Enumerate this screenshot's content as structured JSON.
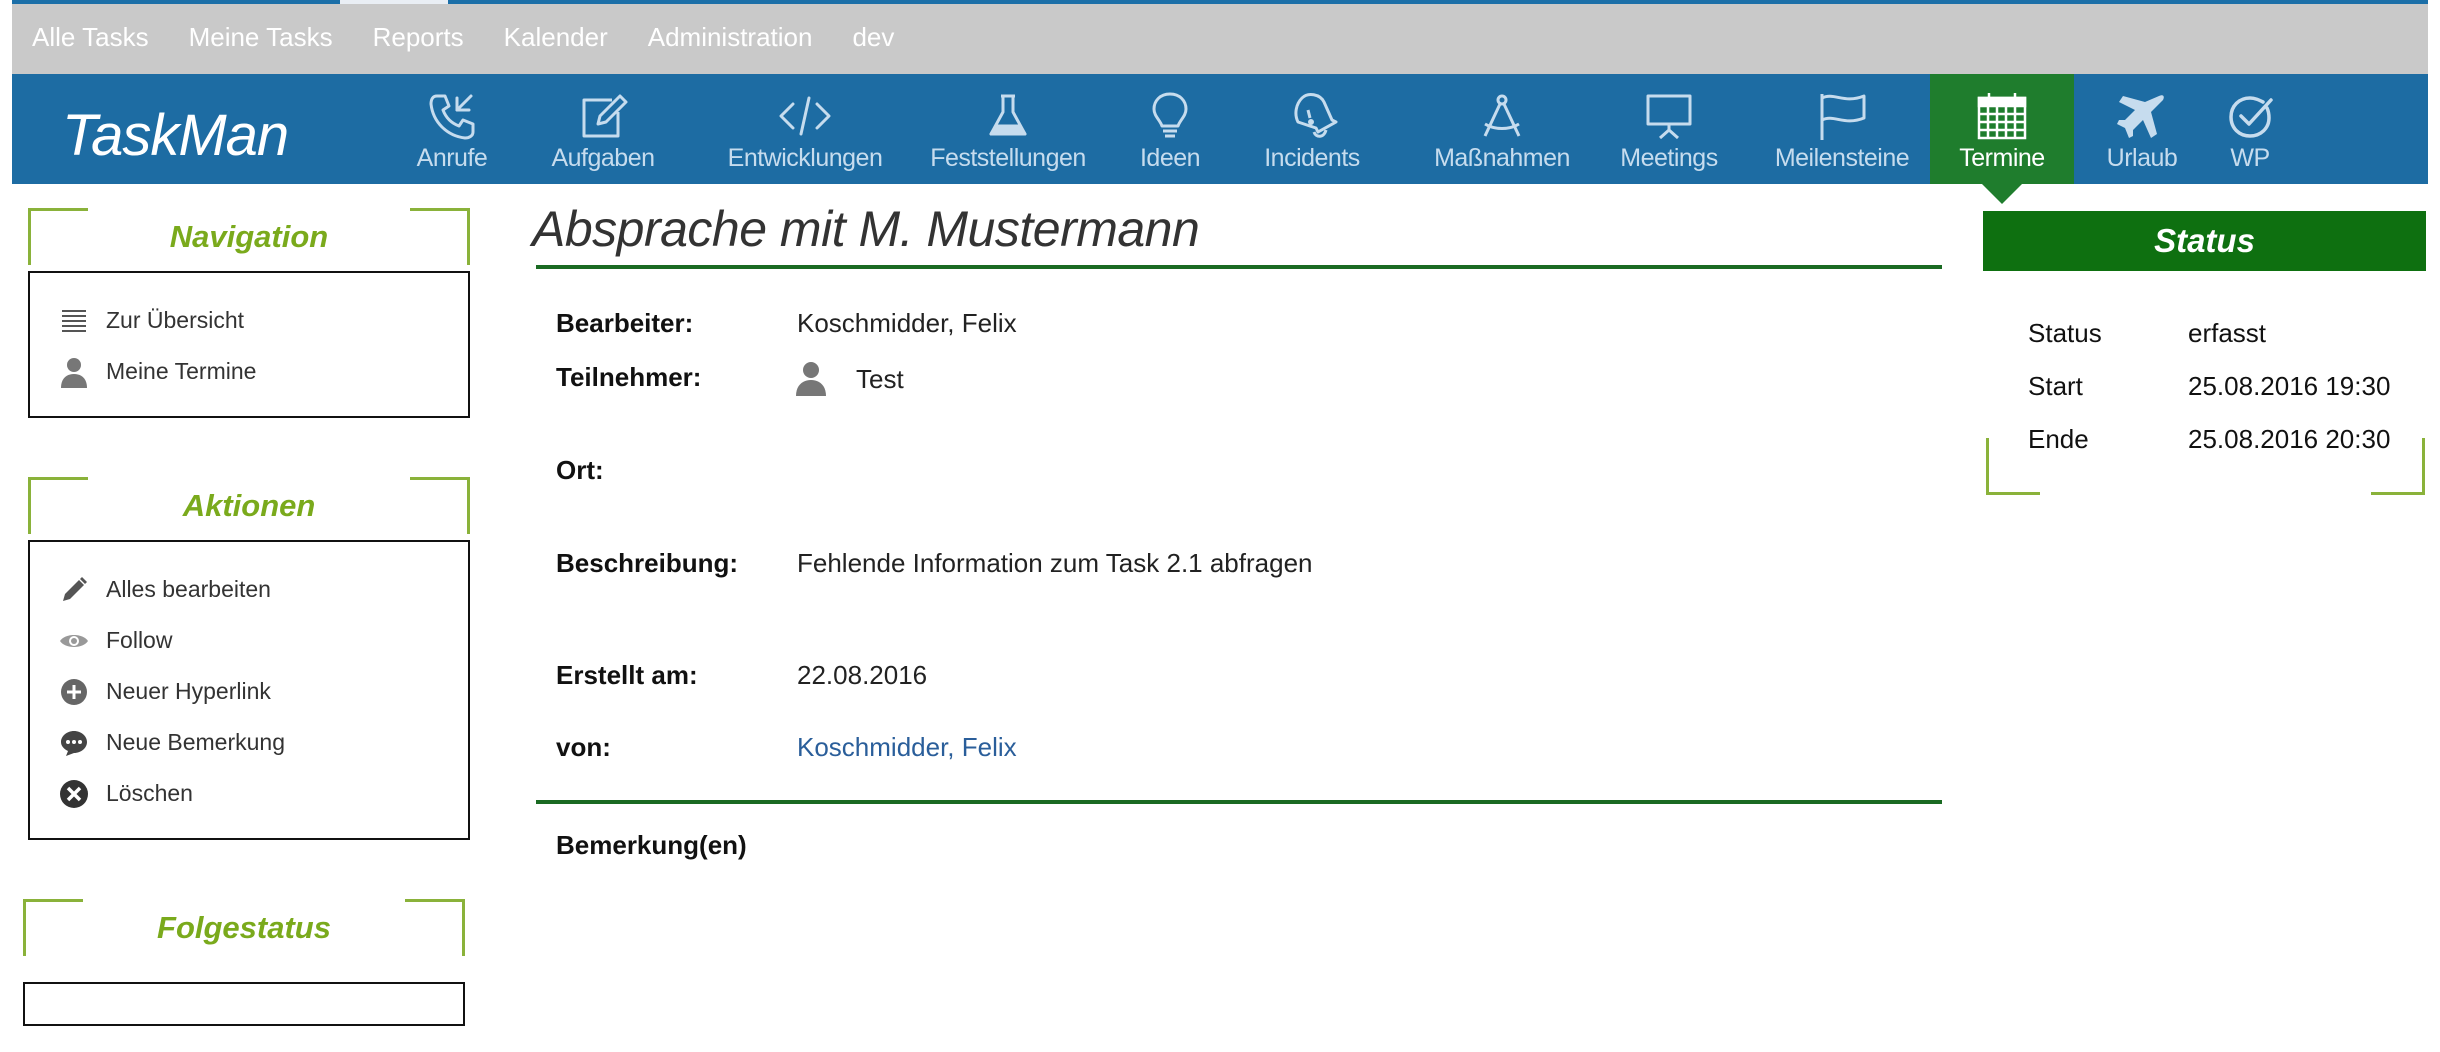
{
  "top_nav": [
    "Alle Tasks",
    "Meine Tasks",
    "Reports",
    "Kalender",
    "Administration",
    "dev"
  ],
  "header": {
    "logo": "TaskMan",
    "items": [
      {
        "label": "Anrufe",
        "icon": "phone-icon"
      },
      {
        "label": "Aufgaben",
        "icon": "edit-icon"
      },
      {
        "label": "Entwicklungen",
        "icon": "code-icon"
      },
      {
        "label": "Feststellungen",
        "icon": "flask-icon"
      },
      {
        "label": "Ideen",
        "icon": "lightbulb-icon"
      },
      {
        "label": "Incidents",
        "icon": "bell-icon"
      },
      {
        "label": "Maßnahmen",
        "icon": "compass-icon"
      },
      {
        "label": "Meetings",
        "icon": "presentation-icon"
      },
      {
        "label": "Meilensteine",
        "icon": "flag-icon"
      },
      {
        "label": "Termine",
        "icon": "calendar-icon",
        "active": true
      },
      {
        "label": "Urlaub",
        "icon": "airplane-icon"
      },
      {
        "label": "WP",
        "icon": "check-circle-icon"
      }
    ]
  },
  "sidebar": {
    "navigation": {
      "title": "Navigation",
      "items": [
        {
          "label": "Zur Übersicht",
          "icon": "list-icon"
        },
        {
          "label": "Meine Termine",
          "icon": "person-icon"
        }
      ]
    },
    "actions": {
      "title": "Aktionen",
      "items": [
        {
          "label": "Alles bearbeiten",
          "icon": "pencil-icon"
        },
        {
          "label": "Follow",
          "icon": "eye-icon"
        },
        {
          "label": "Neuer Hyperlink",
          "icon": "plus-circle-icon"
        },
        {
          "label": "Neue Bemerkung",
          "icon": "comment-icon"
        },
        {
          "label": "Löschen",
          "icon": "x-circle-icon"
        }
      ]
    },
    "followup": {
      "title": "Folgestatus"
    }
  },
  "main": {
    "title": "Absprache mit M. Mustermann",
    "bearbeiter_label": "Bearbeiter:",
    "bearbeiter_value": "Koschmidder, Felix",
    "teilnehmer_label": "Teilnehmer:",
    "teilnehmer_value": "Test",
    "ort_label": "Ort:",
    "beschreibung_label": "Beschreibung:",
    "beschreibung_value": "Fehlende Information zum Task 2.1 abfragen",
    "erstellt_label": "Erstellt am:",
    "erstellt_value": "22.08.2016",
    "von_label": "von:",
    "von_value": "Koschmidder, Felix",
    "bemerkungen_label": "Bemerkung(en)"
  },
  "status_panel": {
    "title": "Status",
    "rows": [
      {
        "label": "Status",
        "value": "erfasst"
      },
      {
        "label": "Start",
        "value": "25.08.2016 19:30"
      },
      {
        "label": "Ende",
        "value": "25.08.2016 20:30"
      }
    ]
  },
  "colors": {
    "header_blue": "#1d6ca3",
    "active_green": "#1f7d2d",
    "accent_lime": "#8ab23a",
    "status_green": "#0e7010",
    "link_blue": "#2a5e9a"
  }
}
